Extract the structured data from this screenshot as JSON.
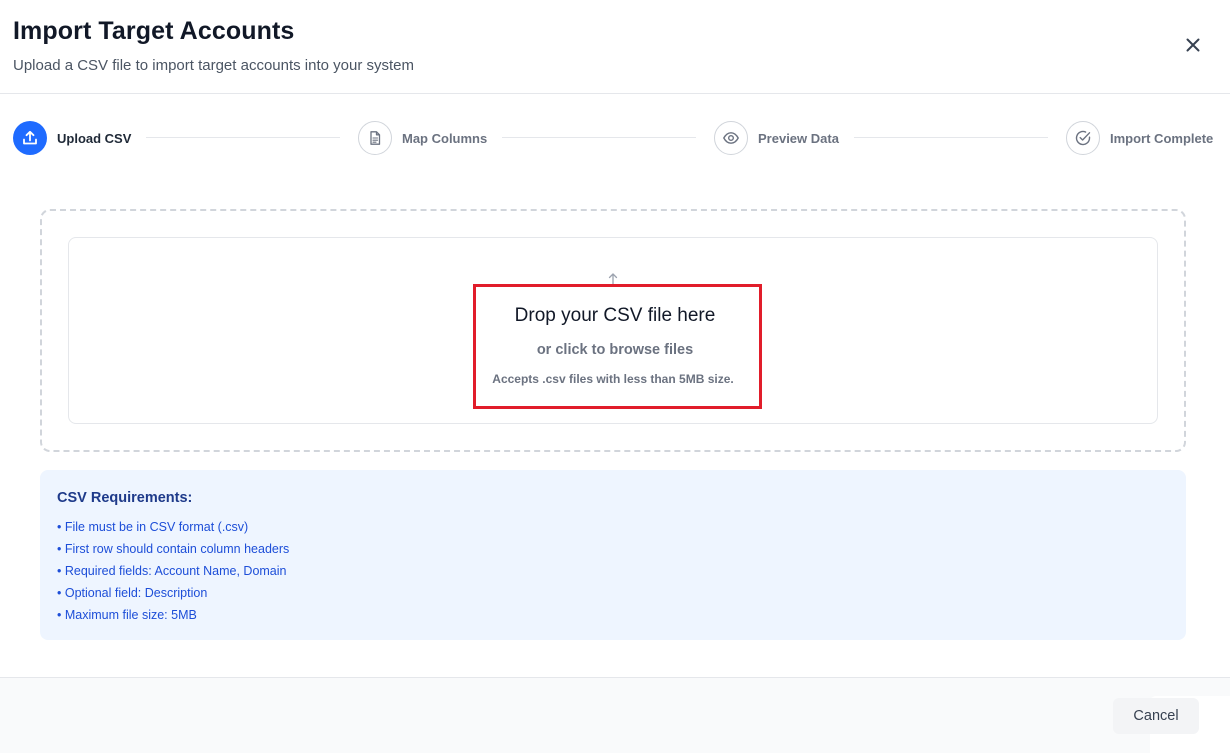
{
  "header": {
    "title": "Import Target Accounts",
    "subtitle": "Upload a CSV file to import target accounts into your system",
    "close_icon": "close-icon"
  },
  "stepper": {
    "steps": [
      {
        "label": "Upload CSV",
        "icon": "upload-icon",
        "state": "active"
      },
      {
        "label": "Map Columns",
        "icon": "document-icon",
        "state": "inactive"
      },
      {
        "label": "Preview Data",
        "icon": "eye-icon",
        "state": "inactive"
      },
      {
        "label": "Import Complete",
        "icon": "check-circle-icon",
        "state": "inactive"
      }
    ]
  },
  "dropzone": {
    "title": "Drop your CSV file here",
    "subtitle": "or click to browse files",
    "note": "Accepts .csv files with less than 5MB size.",
    "icon": "upload-arrow-icon"
  },
  "requirements": {
    "title": "CSV Requirements:",
    "items": [
      "• File must be in CSV format (.csv)",
      "• First row should contain column headers",
      "• Required fields: Account Name, Domain",
      "• Optional field: Description",
      "• Maximum file size: 5MB"
    ]
  },
  "footer": {
    "cancel_label": "Cancel"
  },
  "colors": {
    "accent": "#1f6bff",
    "highlight": "#e11d2a",
    "requirements_bg": "#eef5ff",
    "requirements_text": "#1d4ed8"
  }
}
